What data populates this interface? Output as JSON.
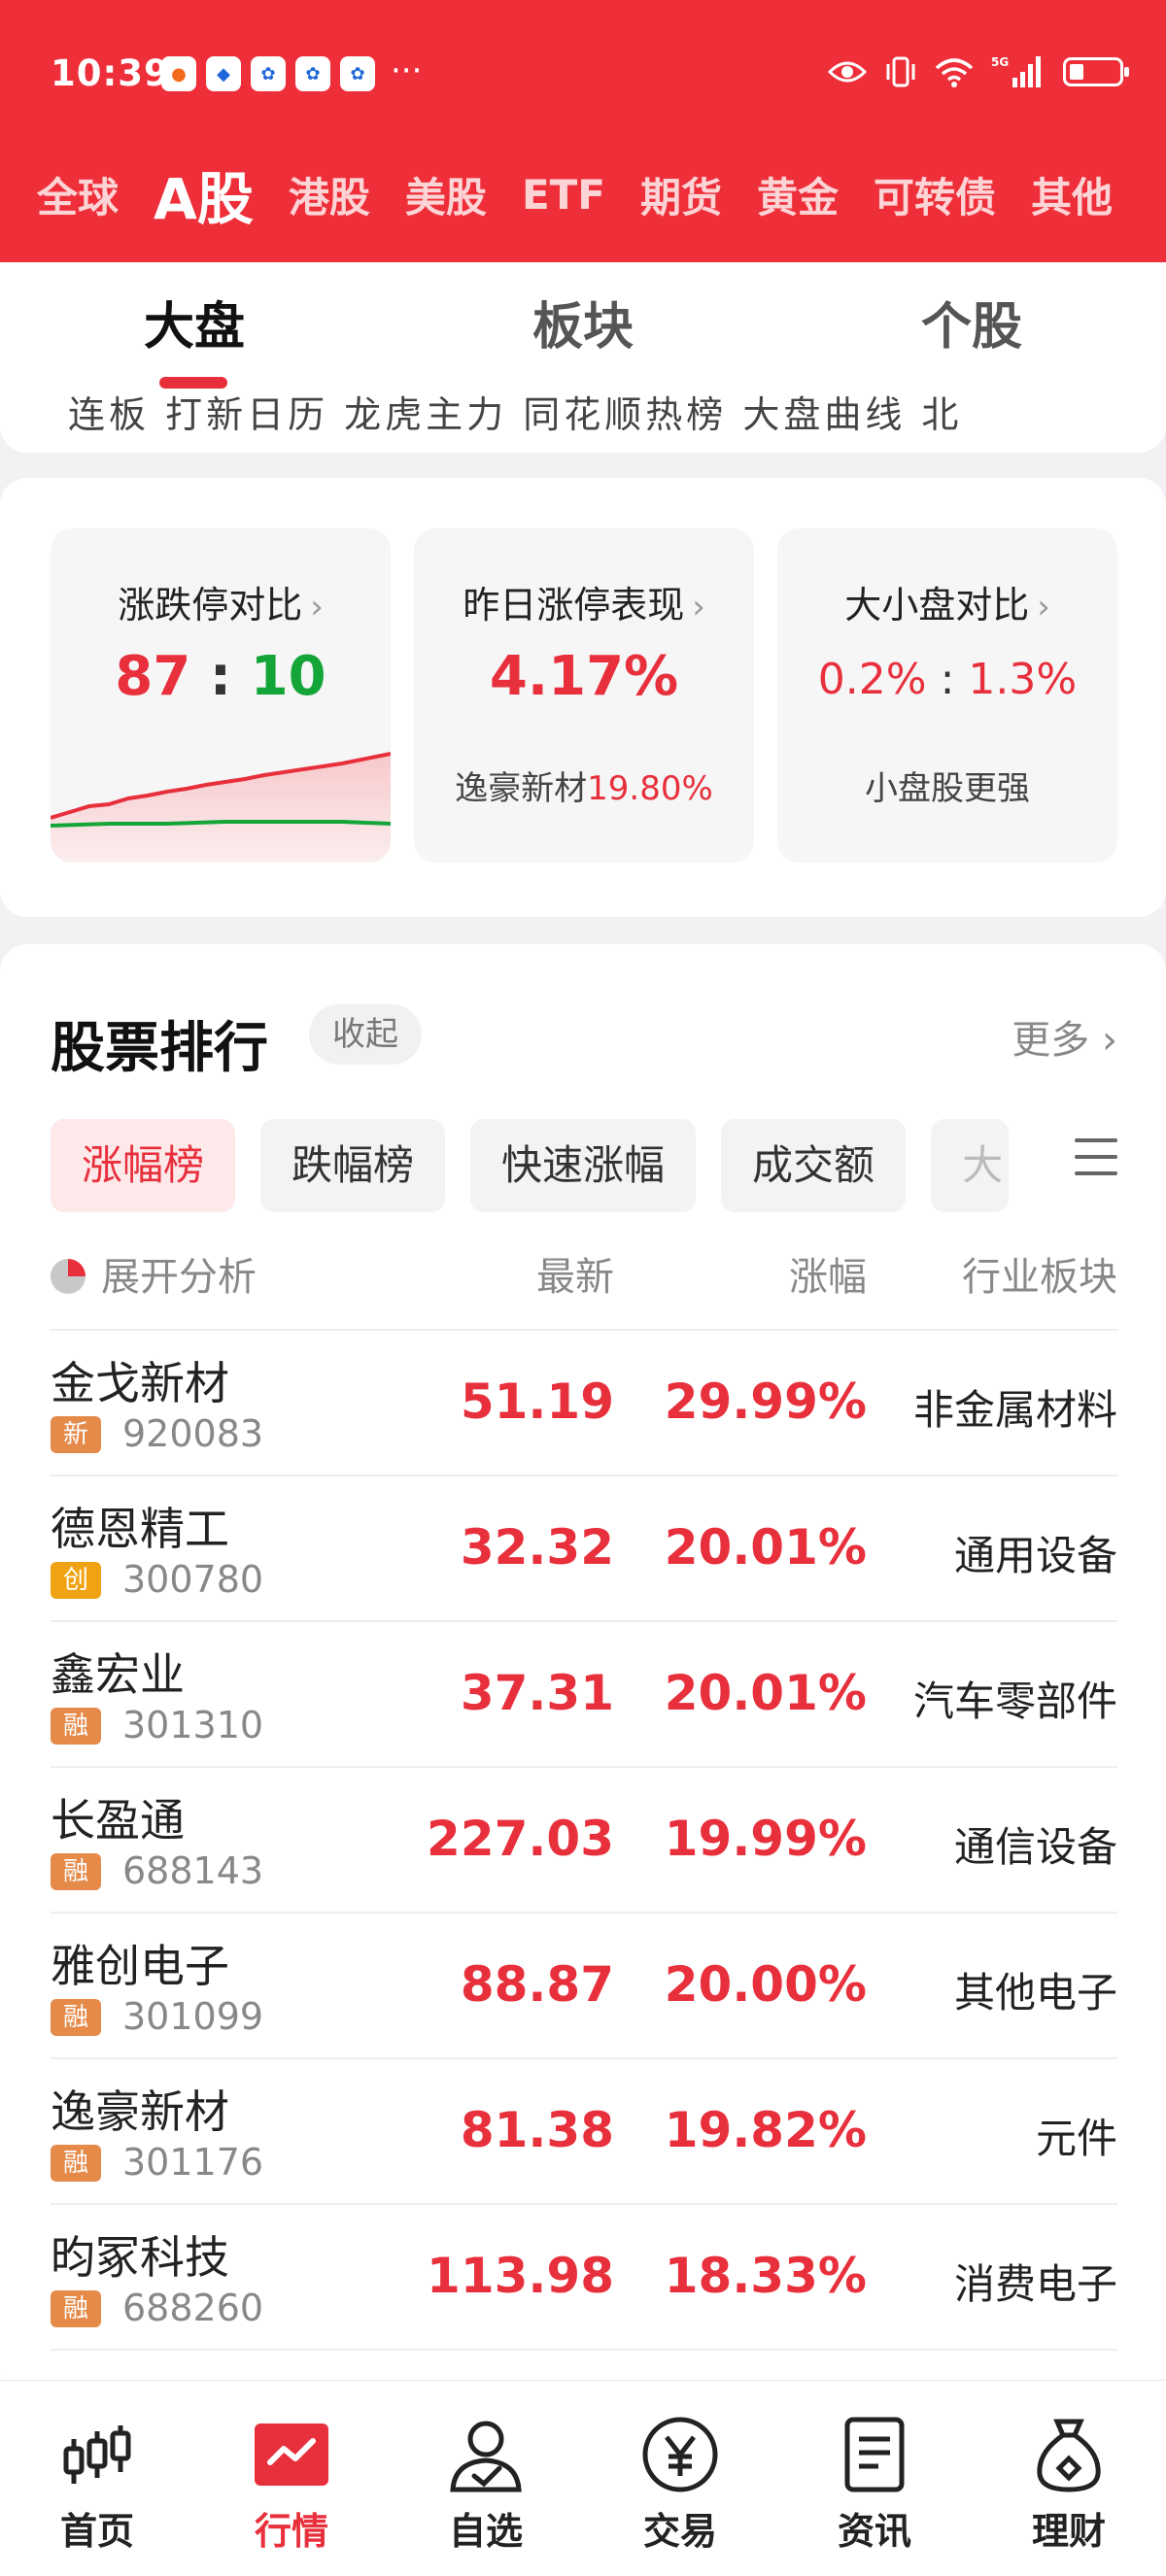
{
  "status_bar": {
    "time": "10:39",
    "more": "···",
    "network": "5G"
  },
  "market_tabs": [
    "全球",
    "A股",
    "港股",
    "美股",
    "ETF",
    "期货",
    "黄金",
    "可转债",
    "其他"
  ],
  "market_tabs_active": 1,
  "sub_tabs": [
    "大盘",
    "板块",
    "个股"
  ],
  "sub_tabs_active": 0,
  "sub_strip_cut": "连板    打新日历    龙虎主力    同花顺热榜    大盘曲线    北",
  "stats": {
    "limit_compare": {
      "title": "涨跌停对比",
      "up": "87",
      "sep": ":",
      "down": "10"
    },
    "yesterday_limit": {
      "title": "昨日涨停表现",
      "value": "4.17%",
      "stock": "逸豪新材",
      "stock_value": "19.80%"
    },
    "cap_compare": {
      "title": "大小盘对比",
      "large": "0.2%",
      "sep": ":",
      "small": "1.3%",
      "note": "小盘股更强"
    }
  },
  "ranking": {
    "title": "股票排行",
    "collapse": "收起",
    "more": "更多 ›",
    "filters": [
      "涨幅榜",
      "跌幅榜",
      "快速涨幅",
      "成交额",
      "大"
    ],
    "headers": {
      "expand": "展开分析",
      "latest": "最新",
      "change": "涨幅",
      "sector": "行业板块"
    },
    "rows": [
      {
        "name": "金戈新材",
        "tag": "新",
        "code": "920083",
        "price": "51.19",
        "change": "29.99%",
        "sector": "非金属材料"
      },
      {
        "name": "德恩精工",
        "tag": "创",
        "code": "300780",
        "price": "32.32",
        "change": "20.01%",
        "sector": "通用设备"
      },
      {
        "name": "鑫宏业",
        "tag": "融",
        "code": "301310",
        "price": "37.31",
        "change": "20.01%",
        "sector": "汽车零部件"
      },
      {
        "name": "长盈通",
        "tag": "融",
        "code": "688143",
        "price": "227.03",
        "change": "19.99%",
        "sector": "通信设备"
      },
      {
        "name": "雅创电子",
        "tag": "融",
        "code": "301099",
        "price": "88.87",
        "change": "20.00%",
        "sector": "其他电子"
      },
      {
        "name": "逸豪新材",
        "tag": "融",
        "code": "301176",
        "price": "81.38",
        "change": "19.82%",
        "sector": "元件"
      },
      {
        "name": "昀冢科技",
        "tag": "融",
        "code": "688260",
        "price": "113.98",
        "change": "18.33%",
        "sector": "消费电子"
      }
    ]
  },
  "bottom_nav": [
    {
      "label": "首页",
      "icon": "candlestick-icon"
    },
    {
      "label": "行情",
      "icon": "trend-icon"
    },
    {
      "label": "自选",
      "icon": "user-check-icon"
    },
    {
      "label": "交易",
      "icon": "yen-coin-icon"
    },
    {
      "label": "资讯",
      "icon": "document-icon"
    },
    {
      "label": "理财",
      "icon": "money-bag-icon"
    }
  ],
  "bottom_nav_active": 1,
  "colors": {
    "brand_red": "#ee2f3a",
    "up_red": "#e8303c",
    "down_green": "#13a538"
  }
}
